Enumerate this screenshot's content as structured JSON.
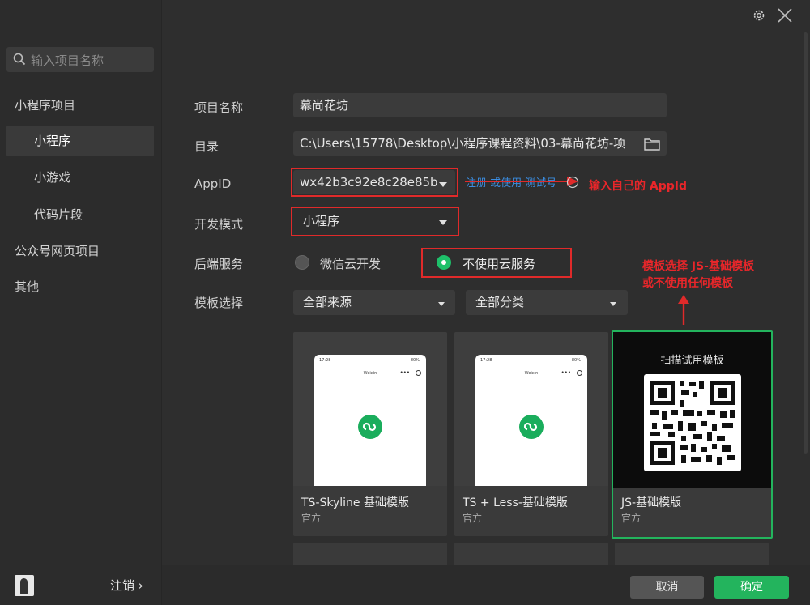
{
  "sidebar": {
    "search_placeholder": "输入项目名称",
    "items": [
      {
        "label": "小程序项目"
      },
      {
        "label": "小程序"
      },
      {
        "label": "小游戏"
      },
      {
        "label": "代码片段"
      },
      {
        "label": "公众号网页项目"
      },
      {
        "label": "其他"
      }
    ],
    "logout_label": "注销 ›"
  },
  "form": {
    "name_label": "项目名称",
    "name_value": "幕尚花坊",
    "dir_label": "目录",
    "dir_value": "C:\\Users\\15778\\Desktop\\小程序课程资料\\03-幕尚花坊-项",
    "appid_label": "AppID",
    "appid_value": "wx42b3c92e8c28e85b",
    "appid_links": "注册 或使用 测试号",
    "dev_mode_label": "开发模式",
    "dev_mode_value": "小程序",
    "backend_label": "后端服务",
    "backend_option_1": "微信云开发",
    "backend_option_2": "不使用云服务",
    "template_label": "模板选择",
    "source_filter": "全部来源",
    "category_filter": "全部分类"
  },
  "annotations": {
    "appid_note": "输入自己的 AppId",
    "template_note_line1": "模板选择 JS-基础模板",
    "template_note_line2": "或不使用任何模板"
  },
  "templates": [
    {
      "name": "TS-Skyline 基础模版",
      "source": "官方",
      "phone_time": "17:28",
      "phone_battery": "80%",
      "phone_title": "Weixin"
    },
    {
      "name": "TS + Less-基础模版",
      "source": "官方",
      "phone_time": "17:28",
      "phone_battery": "80%",
      "phone_title": "Weixin"
    },
    {
      "name": "JS-基础模版",
      "source": "官方",
      "qr_title": "扫描试用模板"
    }
  ],
  "footer": {
    "cancel_label": "取消",
    "confirm_label": "确定"
  },
  "colors": {
    "accent": "#23b45d",
    "annotation_red": "#e02a2a",
    "link_blue": "#3b8de0"
  }
}
